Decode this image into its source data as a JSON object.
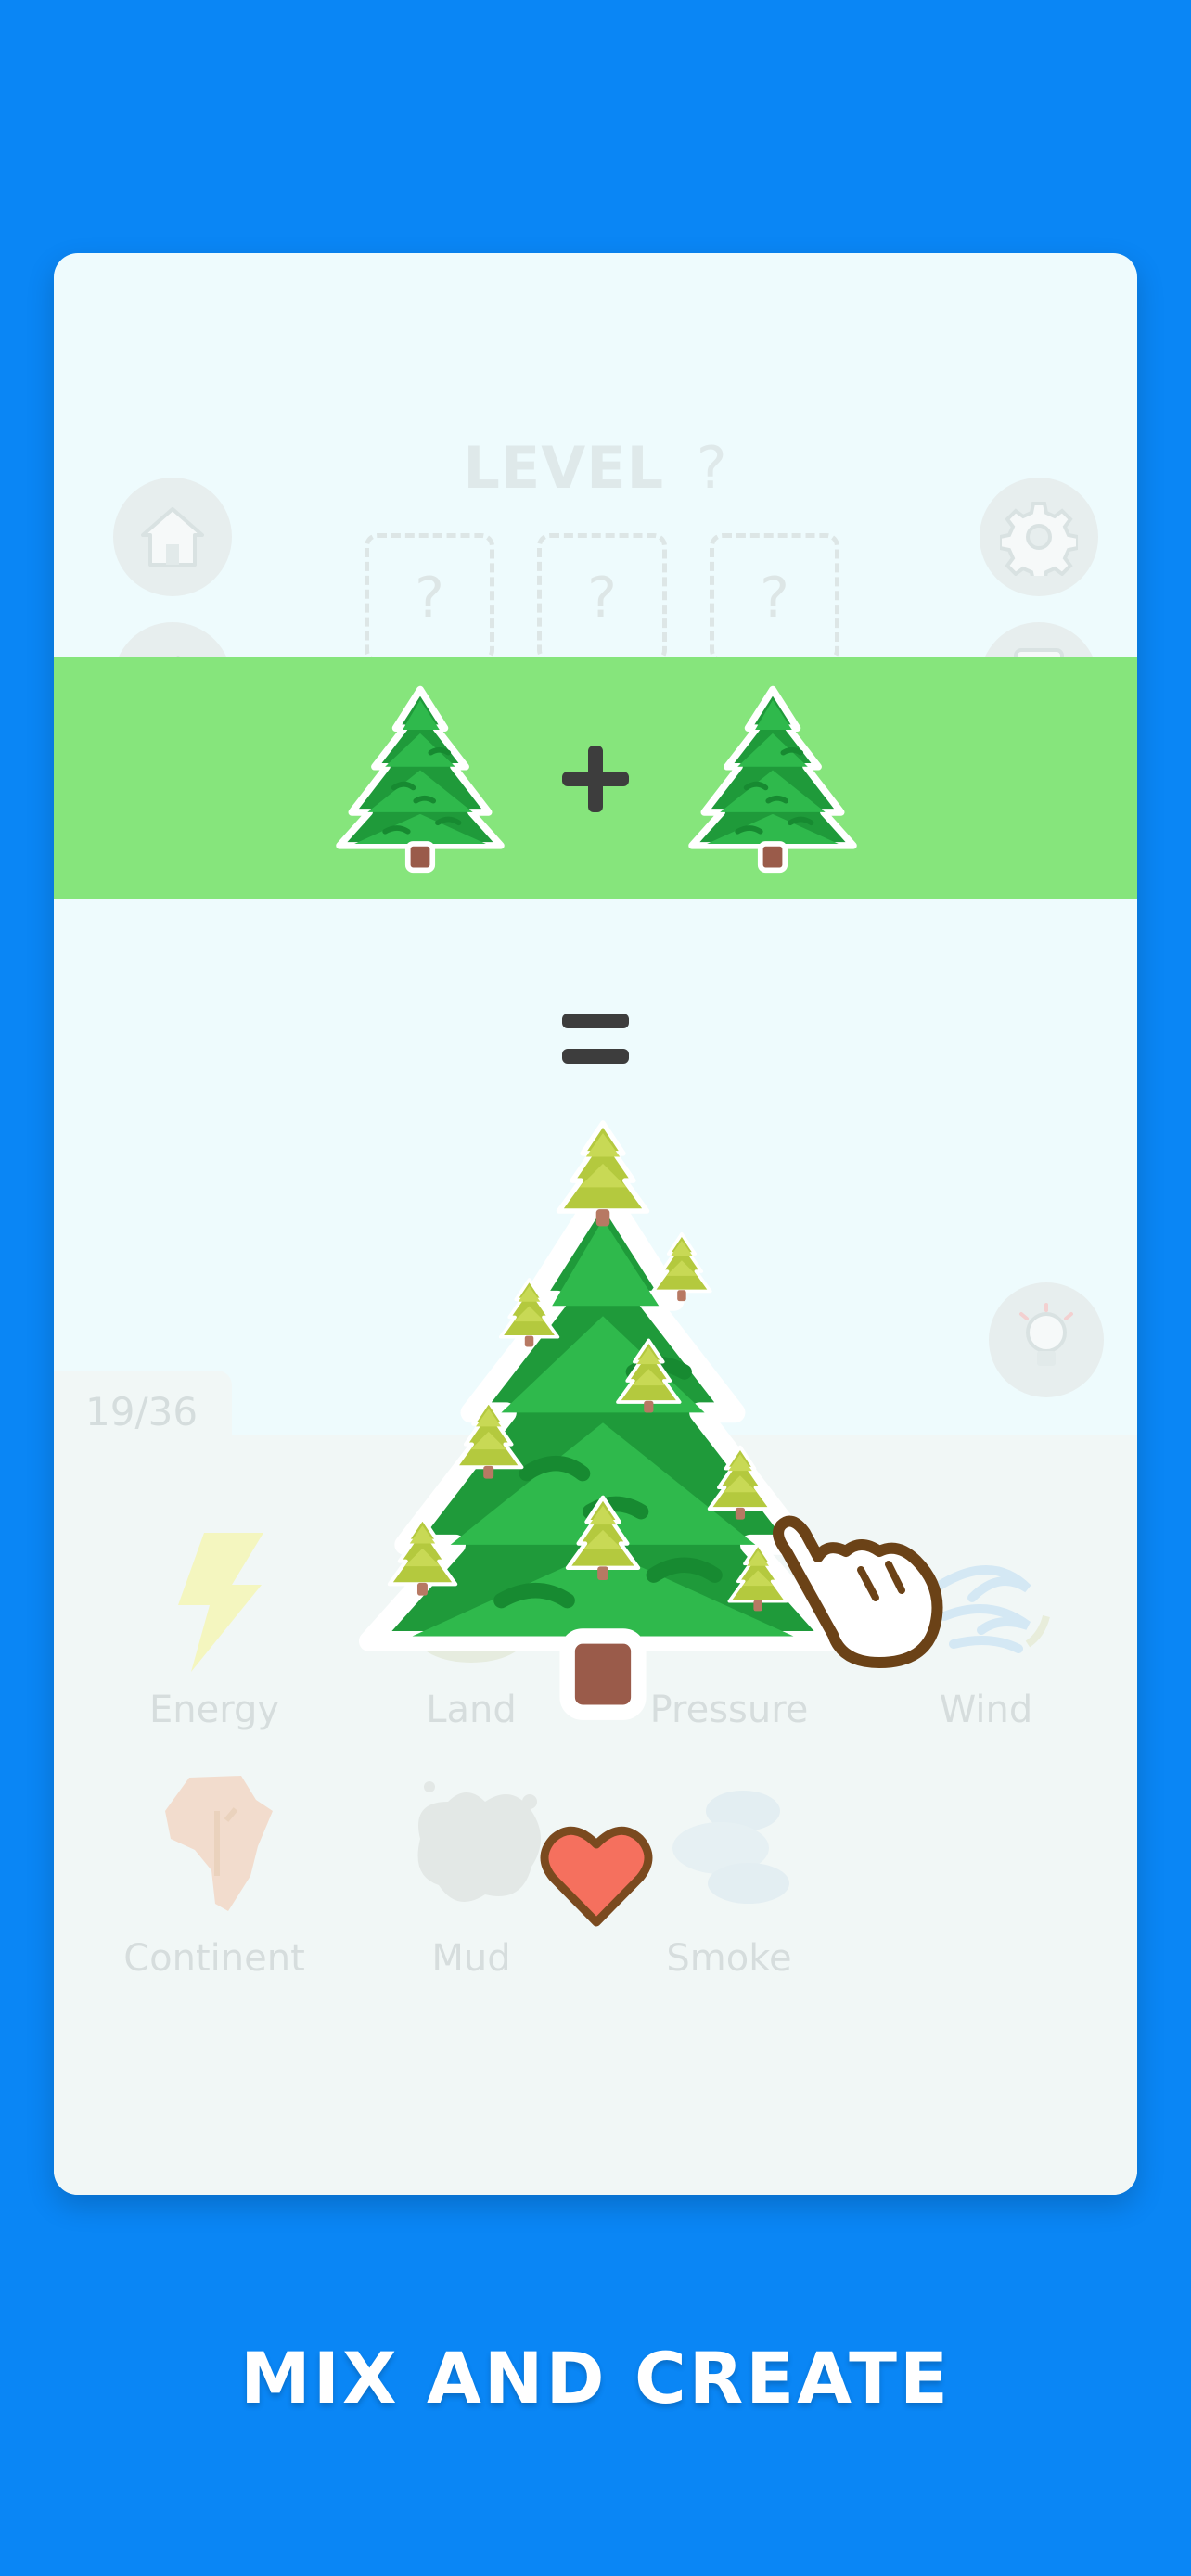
{
  "header": {
    "level_label": "LEVEL",
    "level_value": "?"
  },
  "slots": [
    "?",
    "?",
    "?"
  ],
  "combination": {
    "left_icon": "pine-tree",
    "operator": "+",
    "right_icon": "pine-tree",
    "result_icon": "big-pine-tree-with-small-trees"
  },
  "inventory": {
    "counter": "19/36",
    "items": [
      {
        "label": "Energy",
        "icon": "lightning-icon"
      },
      {
        "label": "Land",
        "icon": "land-icon"
      },
      {
        "label": "Pressure",
        "icon": "pressure-icon"
      },
      {
        "label": "Wind",
        "icon": "wind-icon"
      },
      {
        "label": "Continent",
        "icon": "africa-icon"
      },
      {
        "label": "Mud",
        "icon": "mud-icon"
      },
      {
        "label": "Smoke",
        "icon": "smoke-icon"
      }
    ]
  },
  "footer": {
    "title": "MIX AND CREATE"
  },
  "colors": {
    "background": "#0a86f5",
    "banner": "#86e57c",
    "card": "#eefbfd"
  }
}
